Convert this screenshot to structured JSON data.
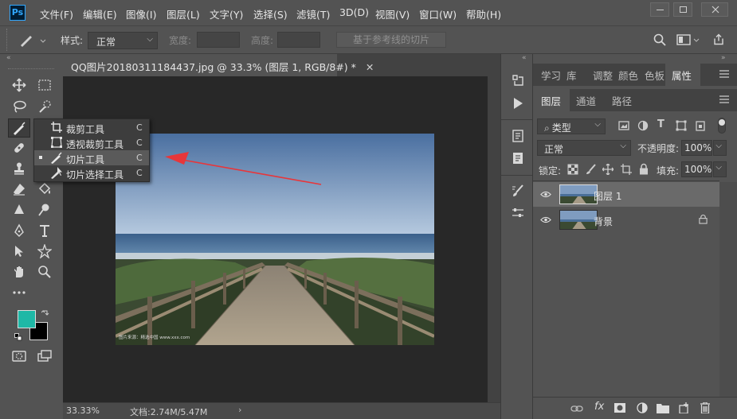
{
  "app": {
    "logo": "Ps"
  },
  "menu": [
    "文件(F)",
    "编辑(E)",
    "图像(I)",
    "图层(L)",
    "文字(Y)",
    "选择(S)",
    "滤镜(T)",
    "3D(D)",
    "视图(V)",
    "窗口(W)",
    "帮助(H)"
  ],
  "options": {
    "style_label": "样式:",
    "style_value": "正常",
    "width_label": "宽度:",
    "height_label": "高度:",
    "slice_from_guides": "基于参考线的切片"
  },
  "document": {
    "tab_title": "QQ图片20180311184437.jpg @ 33.3% (图层 1, RGB/8#) *",
    "watermark": "图片来源：精选中国 www.xxx.com"
  },
  "flyout": {
    "items": [
      {
        "label": "裁剪工具",
        "key": "C",
        "icon": "crop-icon",
        "selected": false
      },
      {
        "label": "透视裁剪工具",
        "key": "C",
        "icon": "perspective-crop-icon",
        "selected": false
      },
      {
        "label": "切片工具",
        "key": "C",
        "icon": "slice-icon",
        "selected": true
      },
      {
        "label": "切片选择工具",
        "key": "C",
        "icon": "slice-select-icon",
        "selected": false
      }
    ]
  },
  "status": {
    "zoom": "33.33%",
    "doc_info": "文档:2.74M/5.47M"
  },
  "right_panel": {
    "top_tabs": [
      "学习",
      "库",
      "调整",
      "颜色",
      "色板",
      "属性"
    ],
    "layer_tabs": [
      "图层",
      "通道",
      "路径"
    ],
    "filter_value": "类型",
    "blend_mode": "正常",
    "opacity_label": "不透明度:",
    "opacity_value": "100%",
    "lock_label": "锁定:",
    "fill_label": "填充:",
    "fill_value": "100%",
    "layers": [
      {
        "name": "图层 1",
        "selected": true,
        "locked": false
      },
      {
        "name": "背景",
        "selected": false,
        "locked": true
      }
    ]
  },
  "colors": {
    "foreground": "#1fb8a6",
    "background": "#000000",
    "accent_arrow": "#e8363a"
  }
}
